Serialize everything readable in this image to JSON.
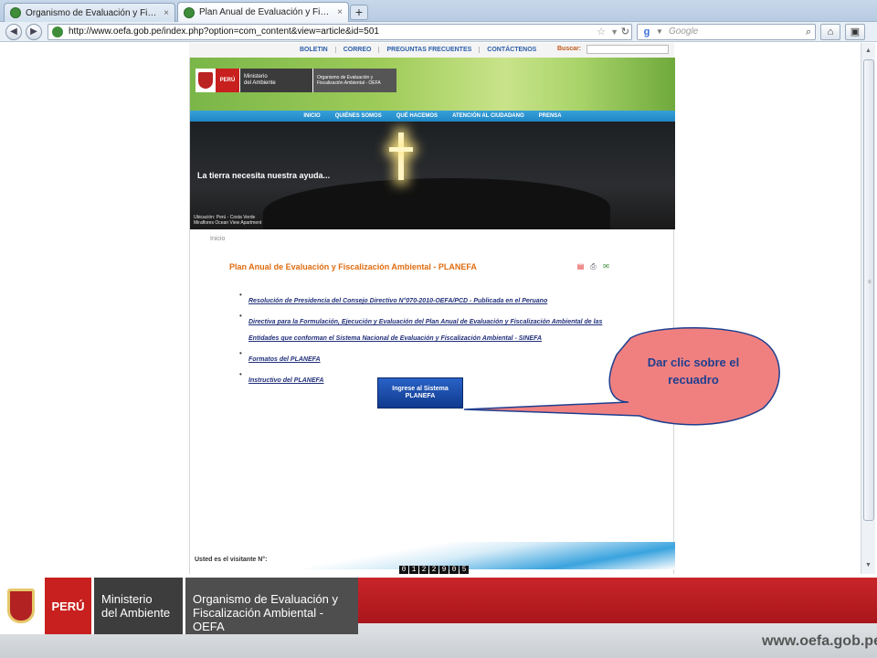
{
  "browser": {
    "tabs": [
      {
        "label": "Organismo de Evaluación y Fiscalizaci...",
        "close": "×"
      },
      {
        "label": "Plan Anual de Evaluación y Fiscalizaci...",
        "close": "×"
      }
    ],
    "new_tab": "+",
    "url": "http://www.oefa.gob.pe/index.php?option=com_content&view=article&id=501",
    "search_placeholder": "Google"
  },
  "site": {
    "top_links": [
      "BOLETIN",
      "CORREO",
      "PREGUNTAS FRECUENTES",
      "CONTÁCTENOS"
    ],
    "search_label": "Buscar:",
    "logo": {
      "peru": "PERÚ",
      "ministerio": "Ministerio\ndel Ambiente",
      "oefa": "Organismo de Evaluación y\nFiscalización Ambiental - OEFA"
    },
    "menu": [
      "INICIO",
      "QUIÉNES SOMOS",
      "QUÉ HACEMOS",
      "ATENCIÓN AL CIUDADANO",
      "PRENSA"
    ],
    "banner_text": "La tierra necesita nuestra ayuda...",
    "banner_caption_1": "Ubicación: Perú - Costa Verde",
    "banner_caption_2": "Miraflores Ocean View Apartment",
    "breadcrumb": "Inicio",
    "article_title": "Plan Anual de Evaluación y Fiscalización Ambiental - PLANEFA",
    "links": [
      "Resolución de Presidencia del Consejo Directivo N°070-2010-OEFA/PCD - Publicada en el Peruano",
      "Directiva para la Formulación, Ejecución y Evaluación del Plan Anual de Evaluación y Fiscalización Ambiental de las Entidades que conforman el Sistema Nacional de Evaluación y Fiscalización Ambiental - SINEFA",
      "Formatos del PLANEFA",
      "Instructivo del PLANEFA"
    ],
    "planefa_button": {
      "line1": "Ingrese al Sistema",
      "line2": "PLANEFA"
    },
    "visitor_label": "Usted es el visitante N°:",
    "visitor_digits": [
      "0",
      "1",
      "2",
      "2",
      "9",
      "0",
      "5"
    ]
  },
  "callout": {
    "line1": "Dar clic sobre el",
    "line2": "recuadro",
    "fill": "#f08080",
    "text_color": "#1f3f8f"
  },
  "slide_footer": {
    "peru": "PERÚ",
    "ministerio_1": "Ministerio",
    "ministerio_2": "del Ambiente",
    "oefa_1": "Organismo de Evaluación y",
    "oefa_2": "Fiscalización Ambiental -OEFA",
    "url": "www.oefa.gob.pe"
  }
}
